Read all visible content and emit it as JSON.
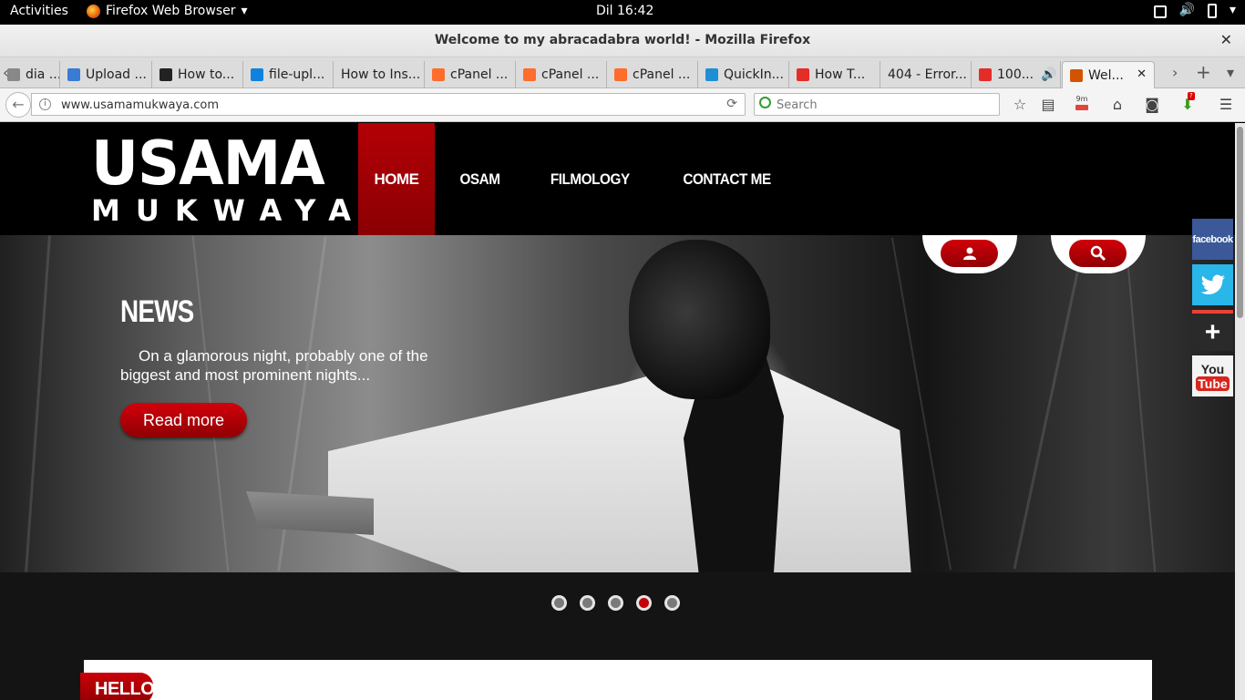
{
  "system": {
    "activities": "Activities",
    "app_menu": "Firefox Web Browser",
    "app_menu_arrow": "▾",
    "clock": "Dil 16:42",
    "clock_dot": "•"
  },
  "window": {
    "title": "Welcome to my abracadabra world! - Mozilla Firefox",
    "close": "✕"
  },
  "tabs": [
    {
      "label": "dia ...",
      "icon": "generic-icon",
      "color": "#888888"
    },
    {
      "label": "Upload ...",
      "icon": "upload-icon",
      "color": "#3a7bd5"
    },
    {
      "label": "How to...",
      "icon": "quote-icon",
      "color": "#222222"
    },
    {
      "label": "file-upl...",
      "icon": "dropbox-icon",
      "color": "#1081de"
    },
    {
      "label": "How to Ins...",
      "icon": "none",
      "color": "#888888"
    },
    {
      "label": "cPanel ...",
      "icon": "cpanel-icon",
      "color": "#ff6c2c"
    },
    {
      "label": "cPanel ...",
      "icon": "cpanel-icon",
      "color": "#ff6c2c"
    },
    {
      "label": "cPanel ...",
      "icon": "cpanel-icon",
      "color": "#ff6c2c"
    },
    {
      "label": "QuickIn...",
      "icon": "gear-icon",
      "color": "#1f8fd4"
    },
    {
      "label": "How T...",
      "icon": "youtube-icon",
      "color": "#e52d27"
    },
    {
      "label": "404 - Error...",
      "icon": "none",
      "color": "#888888"
    },
    {
      "label": "100...",
      "icon": "youtube-icon",
      "color": "#e52d27"
    },
    {
      "label": "Wel...",
      "icon": "site-icon",
      "color": "#d35400"
    }
  ],
  "tab_controls": {
    "scroll_left": "‹",
    "scroll_right": "›",
    "new_tab": "+",
    "all_tabs": "▾",
    "audio": "🔊",
    "close": "✕"
  },
  "navigation": {
    "url": "www.usamamukwaya.com",
    "search_placeholder": "Search",
    "reload": "⟳",
    "back": "←",
    "info": "i",
    "timer_badge": "9m",
    "download_badge": "?"
  },
  "site": {
    "logo_line1": "USAMA",
    "logo_line2": "MUKWAYA",
    "nav": [
      "HOME",
      "OSAM",
      "FILMOLOGY",
      "CONTACT ME"
    ],
    "hero": {
      "title": "NEWS",
      "text": "On a glamorous night, probably one of the biggest and most prominent nights...",
      "button": "Read more"
    },
    "social": {
      "facebook": "facebook",
      "youtube_top": "You",
      "youtube_bottom": "Tube",
      "google": "+"
    },
    "slider": {
      "count": 5,
      "active_index": 3
    },
    "hello": "HELLO!"
  },
  "colors": {
    "brand_red": "#b30006",
    "header_bg": "#000000"
  }
}
